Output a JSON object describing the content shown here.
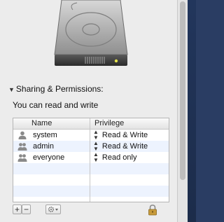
{
  "section": {
    "title": "Sharing & Permissions:",
    "permission_summary": "You can read and write"
  },
  "table": {
    "columns": [
      "Name",
      "Privilege"
    ],
    "rows": [
      {
        "name": "system",
        "privilege": "Read & Write",
        "icon": "single-user-icon"
      },
      {
        "name": "admin",
        "privilege": "Read & Write",
        "icon": "group-icon"
      },
      {
        "name": "everyone",
        "privilege": "Read only",
        "icon": "group-icon"
      }
    ]
  },
  "toolbar": {
    "add_label": "+",
    "remove_label": "−",
    "action_icon": "gear-icon",
    "lock_icon": "lock-icon"
  }
}
